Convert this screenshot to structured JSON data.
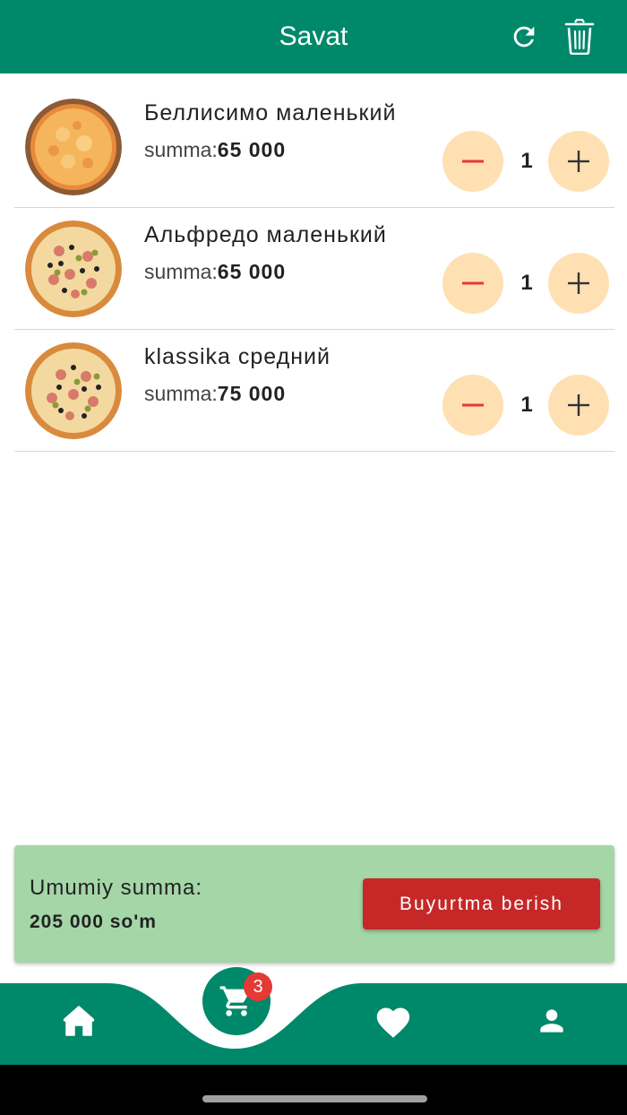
{
  "header": {
    "title": "Savat",
    "refresh_icon": "refresh-icon",
    "trash_icon": "trash-icon",
    "bg_color": "#00886a"
  },
  "cart": {
    "items": [
      {
        "name": "Беллисимо маленький",
        "price_label": "summa:",
        "price": "65 000",
        "quantity": "1",
        "image": "pizza-image"
      },
      {
        "name": "Альфредо маленький",
        "price_label": "summa:",
        "price": "65 000",
        "quantity": "1",
        "image": "pizza-image"
      },
      {
        "name": "klassika средний",
        "price_label": "summa:",
        "price": "75 000",
        "quantity": "1",
        "image": "pizza-image"
      }
    ]
  },
  "summary": {
    "label": "Umumiy summa:",
    "total": "205 000 so'm",
    "order_button": "Buyurtma berish",
    "bg_color": "#a5d6a7",
    "button_color": "#c62828"
  },
  "bottom_nav": {
    "items": [
      "home-icon",
      "cart-icon",
      "heart-icon",
      "person-icon"
    ],
    "cart_badge": "3",
    "badge_color": "#e53935"
  }
}
